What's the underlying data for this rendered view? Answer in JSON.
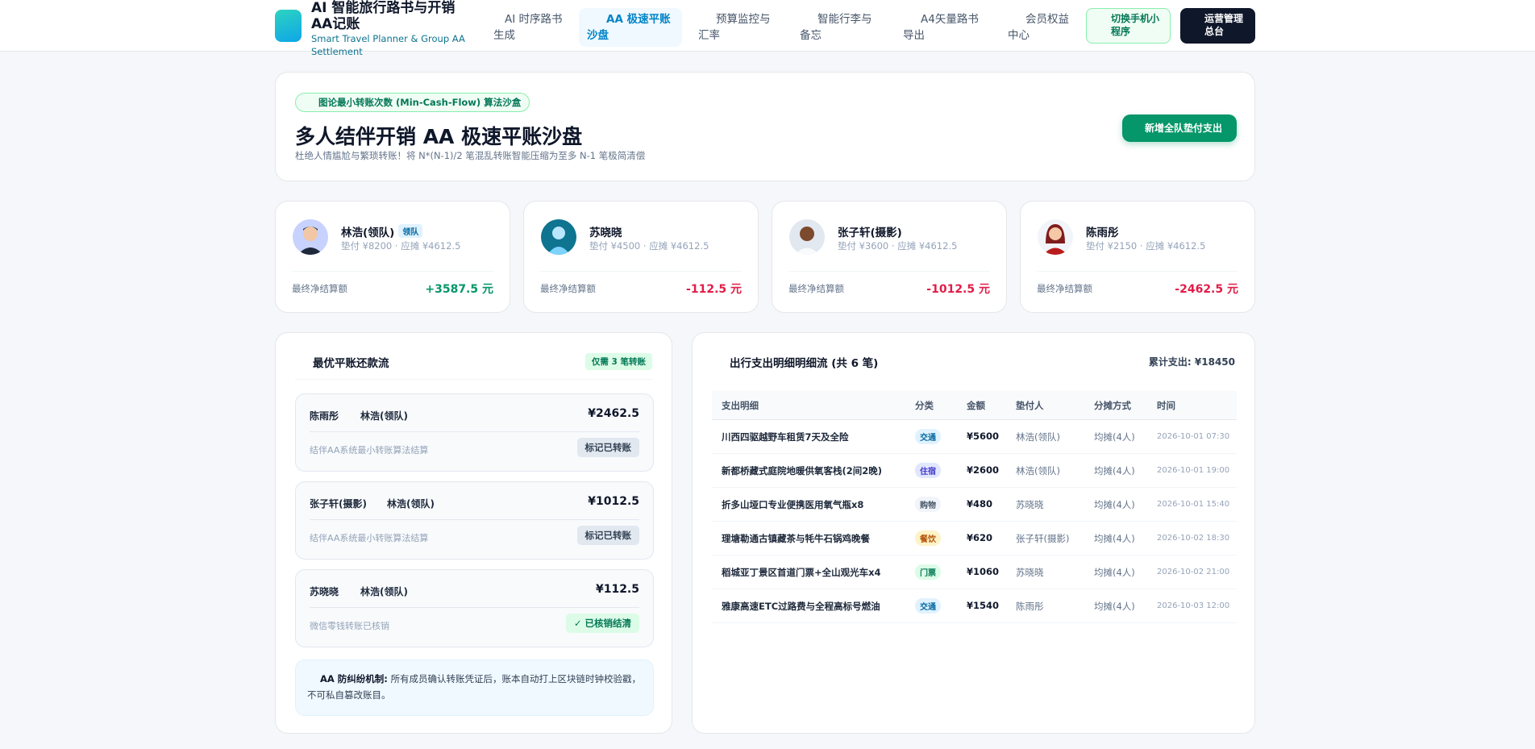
{
  "header": {
    "brand_title": "AI 智能旅行路书与开销AA记账",
    "brand_sub": "Smart Travel Planner & Group AA Settlement",
    "nav": [
      {
        "label": "AI 时序路书生成",
        "active": false
      },
      {
        "label": "AA 极速平账沙盘",
        "active": true
      },
      {
        "label": "预算监控与汇率",
        "active": false
      },
      {
        "label": "智能行李与备忘",
        "active": false
      },
      {
        "label": "A4矢量路书导出",
        "active": false
      },
      {
        "label": "会员权益中心",
        "active": false
      }
    ],
    "switch_mini": "切换手机小程序",
    "admin": "运营管理总台"
  },
  "hero": {
    "tag": "图论最小转账次数 (Min-Cash-Flow) 算法沙盒",
    "title": "多人结伴开销 AA 极速平账沙盘",
    "desc": "杜绝人情尴尬与繁琐转账！将 N*(N-1)/2 笔混乱转账智能压缩为至多 N-1 笔极简清偿",
    "add_button": "新增全队垫付支出"
  },
  "members": [
    {
      "name": "林浩(领队)",
      "badge": "领队",
      "info": "垫付 ¥8200 · 应摊 ¥4612.5",
      "final_label": "最终净结算额",
      "final": "+3587.5 元",
      "positive": true
    },
    {
      "name": "苏晓晓",
      "badge": "",
      "info": "垫付 ¥4500 · 应摊 ¥4612.5",
      "final_label": "最终净结算额",
      "final": "-112.5 元",
      "positive": false
    },
    {
      "name": "张子轩(摄影)",
      "badge": "",
      "info": "垫付 ¥3600 · 应摊 ¥4612.5",
      "final_label": "最终净结算额",
      "final": "-1012.5 元",
      "positive": false
    },
    {
      "name": "陈雨彤",
      "badge": "",
      "info": "垫付 ¥2150 · 应摊 ¥4612.5",
      "final_label": "最终净结算额",
      "final": "-2462.5 元",
      "positive": false
    }
  ],
  "settle": {
    "title": "最优平账还款流",
    "badge": "仅需 3 笔转账",
    "transfers": [
      {
        "from": "陈雨彤",
        "to": "林浩(领队)",
        "amount": "¥2462.5",
        "note": "结伴AA系统最小转账算法结算",
        "action": "标记已转账",
        "done": false
      },
      {
        "from": "张子轩(摄影)",
        "to": "林浩(领队)",
        "amount": "¥1012.5",
        "note": "结伴AA系统最小转账算法结算",
        "action": "标记已转账",
        "done": false
      },
      {
        "from": "苏晓晓",
        "to": "林浩(领队)",
        "amount": "¥112.5",
        "note": "微信零钱转账已核销",
        "action": "✓ 已核销结清",
        "done": true
      }
    ],
    "notice_label": "AA 防纠纷机制:",
    "notice_text": "所有成员确认转账凭证后，账本自动打上区块链时钟校验戳，不可私自篡改账目。"
  },
  "expense": {
    "title": "出行支出明细明细流 (共 6 笔)",
    "total": "累计支出: ¥18450",
    "headers": [
      "支出明细",
      "分类",
      "金额",
      "垫付人",
      "分摊方式",
      "时间"
    ],
    "rows": [
      {
        "desc": "川西四驱越野车租赁7天及全险",
        "cat": "交通",
        "cat_color": "#e0f2fe",
        "cat_text": "#0369a1",
        "amount": "¥5600",
        "payer": "林浩(领队)",
        "split": "均摊(4人)",
        "time": "2026-10-01 07:30"
      },
      {
        "desc": "新都桥藏式庭院地暖供氧客栈(2间2晚)",
        "cat": "住宿",
        "cat_color": "#e0e7ff",
        "cat_text": "#4338ca",
        "amount": "¥2600",
        "payer": "林浩(领队)",
        "split": "均摊(4人)",
        "time": "2026-10-01 19:00"
      },
      {
        "desc": "折多山垭口专业便携医用氧气瓶x8",
        "cat": "购物",
        "cat_color": "#f1f5f9",
        "cat_text": "#475569",
        "amount": "¥480",
        "payer": "苏晓晓",
        "split": "均摊(4人)",
        "time": "2026-10-01 15:40"
      },
      {
        "desc": "理塘勒通古镇藏茶与牦牛石锅鸡晚餐",
        "cat": "餐饮",
        "cat_color": "#fef3c7",
        "cat_text": "#b45309",
        "amount": "¥620",
        "payer": "张子轩(摄影)",
        "split": "均摊(4人)",
        "time": "2026-10-02 18:30"
      },
      {
        "desc": "稻城亚丁景区首道门票+全山观光车x4",
        "cat": "门票",
        "cat_color": "#dcfce7",
        "cat_text": "#047857",
        "amount": "¥1060",
        "payer": "苏晓晓",
        "split": "均摊(4人)",
        "time": "2026-10-02 21:00"
      },
      {
        "desc": "雅康高速ETC过路费与全程高标号燃油",
        "cat": "交通",
        "cat_color": "#e0f2fe",
        "cat_text": "#0369a1",
        "amount": "¥1540",
        "payer": "陈雨彤",
        "split": "均摊(4人)",
        "time": "2026-10-03 12:00"
      }
    ]
  }
}
